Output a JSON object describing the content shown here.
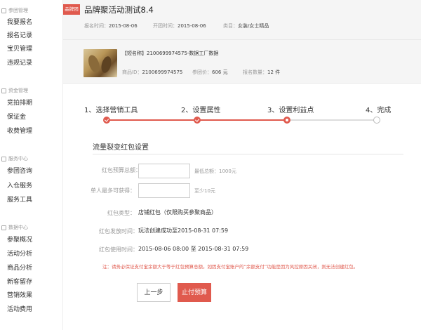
{
  "sidebar": {
    "groups": [
      {
        "title": "参团管理",
        "items": [
          "我要报名",
          "报名记录",
          "宝贝管理",
          "违规记录"
        ]
      },
      {
        "title": "资金管理",
        "items": [
          "竞拍排期",
          "保证金",
          "收费管理"
        ]
      },
      {
        "title": "服务中心",
        "items": [
          "参团咨询",
          "入仓服务",
          "服务工具"
        ]
      },
      {
        "title": "数据中心",
        "items": [
          "参聚概况",
          "活动分析",
          "商品分析",
          "新客留存",
          "营销效果",
          "活动费用"
        ]
      }
    ]
  },
  "header": {
    "badge": "品牌团",
    "title": "品牌聚活动测试8.4",
    "meta": [
      {
        "label": "报名时间：",
        "value": "2015-08-06"
      },
      {
        "label": "开团时间：",
        "value": "2015-08-06"
      },
      {
        "label": "类目：",
        "value": "女装/女士精品"
      }
    ]
  },
  "product": {
    "name": "【短名称】2100699974575-数据工厂数据",
    "meta": [
      {
        "label": "商品ID：",
        "value": "2100699974575"
      },
      {
        "label": "参团价：",
        "value": "606 元"
      },
      {
        "label": "报名数量：",
        "value": "12 件"
      }
    ]
  },
  "steps": [
    {
      "label": "1、选择营销工具",
      "state": "done"
    },
    {
      "label": "2、设置属性",
      "state": "done"
    },
    {
      "label": "3、设置利益点",
      "state": "current"
    },
    {
      "label": "4、完成",
      "state": "todo"
    }
  ],
  "colors": {
    "accent": "#e05a4e"
  },
  "form": {
    "section_title": "流量裂变红包设置",
    "budget": {
      "label": "红包预算总额：",
      "value": "",
      "hint": "最低总额：1000元"
    },
    "per_user": {
      "label": "单人最多可获得：",
      "value": "",
      "hint": "至少10元"
    },
    "type": {
      "label": "红包类型：",
      "value": "店铺红包（仅限购买参聚商品）"
    },
    "issue_time": {
      "label": "红包发放时间：",
      "value": "玩法创建成功至2015-08-31 07:59"
    },
    "use_time": {
      "label": "红包使用时间：",
      "value": "2015-08-06 08:00 至 2015-08-31 07:59"
    }
  },
  "notice": "注：请务必保证支付宝余额大于等于红包预算总额。如因支付宝账户的“余额支付”功能是因为风控原因关闭，则无法创建红包。",
  "buttons": {
    "prev": "上一步",
    "pay": "止付预算"
  }
}
